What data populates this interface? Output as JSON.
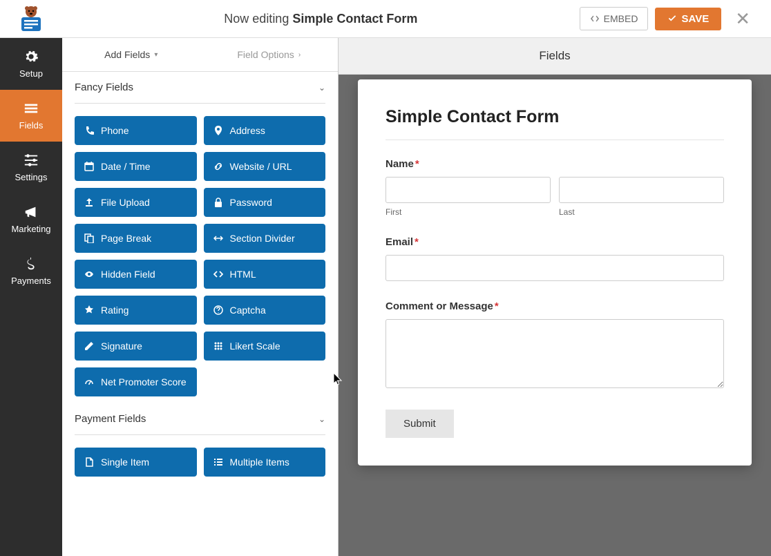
{
  "header": {
    "editing_prefix": "Now editing ",
    "form_name": "Simple Contact Form",
    "embed_label": "EMBED",
    "save_label": "SAVE"
  },
  "sidebar": {
    "items": [
      {
        "label": "Setup"
      },
      {
        "label": "Fields"
      },
      {
        "label": "Settings"
      },
      {
        "label": "Marketing"
      },
      {
        "label": "Payments"
      }
    ]
  },
  "panel": {
    "heading": "Fields",
    "tab_add": "Add Fields",
    "tab_options": "Field Options",
    "groups": [
      {
        "title": "Fancy Fields",
        "fields": [
          {
            "label": "Phone",
            "icon": "phone"
          },
          {
            "label": "Address",
            "icon": "pin"
          },
          {
            "label": "Date / Time",
            "icon": "calendar"
          },
          {
            "label": "Website / URL",
            "icon": "link"
          },
          {
            "label": "File Upload",
            "icon": "upload"
          },
          {
            "label": "Password",
            "icon": "lock"
          },
          {
            "label": "Page Break",
            "icon": "pages"
          },
          {
            "label": "Section Divider",
            "icon": "divider"
          },
          {
            "label": "Hidden Field",
            "icon": "eye"
          },
          {
            "label": "HTML",
            "icon": "code"
          },
          {
            "label": "Rating",
            "icon": "star"
          },
          {
            "label": "Captcha",
            "icon": "help"
          },
          {
            "label": "Signature",
            "icon": "pencil"
          },
          {
            "label": "Likert Scale",
            "icon": "dots"
          },
          {
            "label": "Net Promoter Score",
            "icon": "gauge"
          }
        ]
      },
      {
        "title": "Payment Fields",
        "fields": [
          {
            "label": "Single Item",
            "icon": "file"
          },
          {
            "label": "Multiple Items",
            "icon": "list"
          }
        ]
      }
    ]
  },
  "form": {
    "title": "Simple Contact Form",
    "name_label": "Name",
    "first_sub": "First",
    "last_sub": "Last",
    "email_label": "Email",
    "message_label": "Comment or Message",
    "submit_label": "Submit"
  }
}
